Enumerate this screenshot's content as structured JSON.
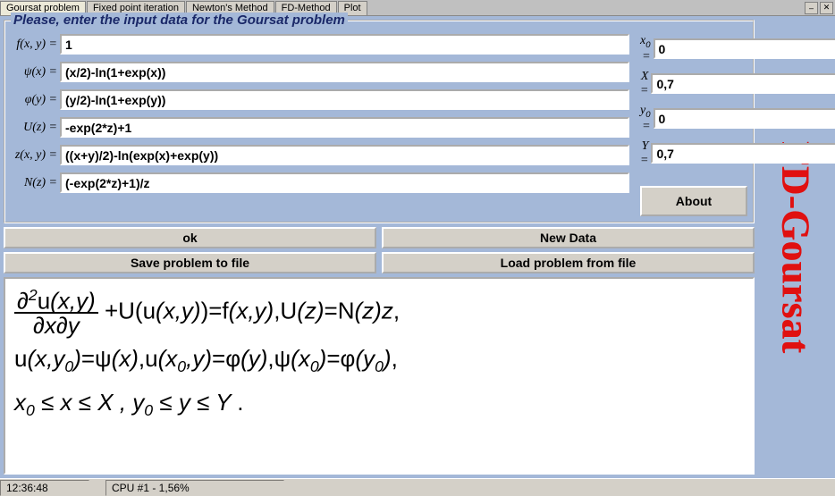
{
  "tabs": [
    {
      "label": "Goursat problem",
      "active": true
    },
    {
      "label": "Fixed point iteration",
      "active": false
    },
    {
      "label": "Newton's Method",
      "active": false
    },
    {
      "label": "FD-Method",
      "active": false
    },
    {
      "label": "Plot",
      "active": false
    }
  ],
  "group_title": "Please, enter the input data for the Goursat problem",
  "fields": {
    "f": {
      "label": "f(x, y) =",
      "value": "1"
    },
    "psi": {
      "label": "ψ(x) =",
      "value": "(x/2)-ln(1+exp(x))"
    },
    "phi": {
      "label": "φ(y) =",
      "value": "(y/2)-ln(1+exp(y))"
    },
    "U": {
      "label": "U(z) =",
      "value": "-exp(2*z)+1"
    },
    "z": {
      "label": "z(x, y) =",
      "value": "((x+y)/2)-ln(exp(x)+exp(y))"
    },
    "N": {
      "label": "N(z) =",
      "value": "(-exp(2*z)+1)/z"
    }
  },
  "bounds": {
    "x0": {
      "label": "x₀ =",
      "value": "0"
    },
    "X": {
      "label": "X =",
      "value": "0,7"
    },
    "y0": {
      "label": "y₀ =",
      "value": "0"
    },
    "Y": {
      "label": "Y =",
      "value": "0,7"
    }
  },
  "buttons": {
    "about": "About",
    "ok": "ok",
    "newdata": "New Data",
    "save": "Save problem to file",
    "load": "Load problem from file"
  },
  "brand": "FD-Goursat",
  "status": {
    "time": "12:36:48",
    "cpu": "CPU #1 -  1,56%"
  },
  "winbtns": {
    "min": "–",
    "close": "✕"
  }
}
